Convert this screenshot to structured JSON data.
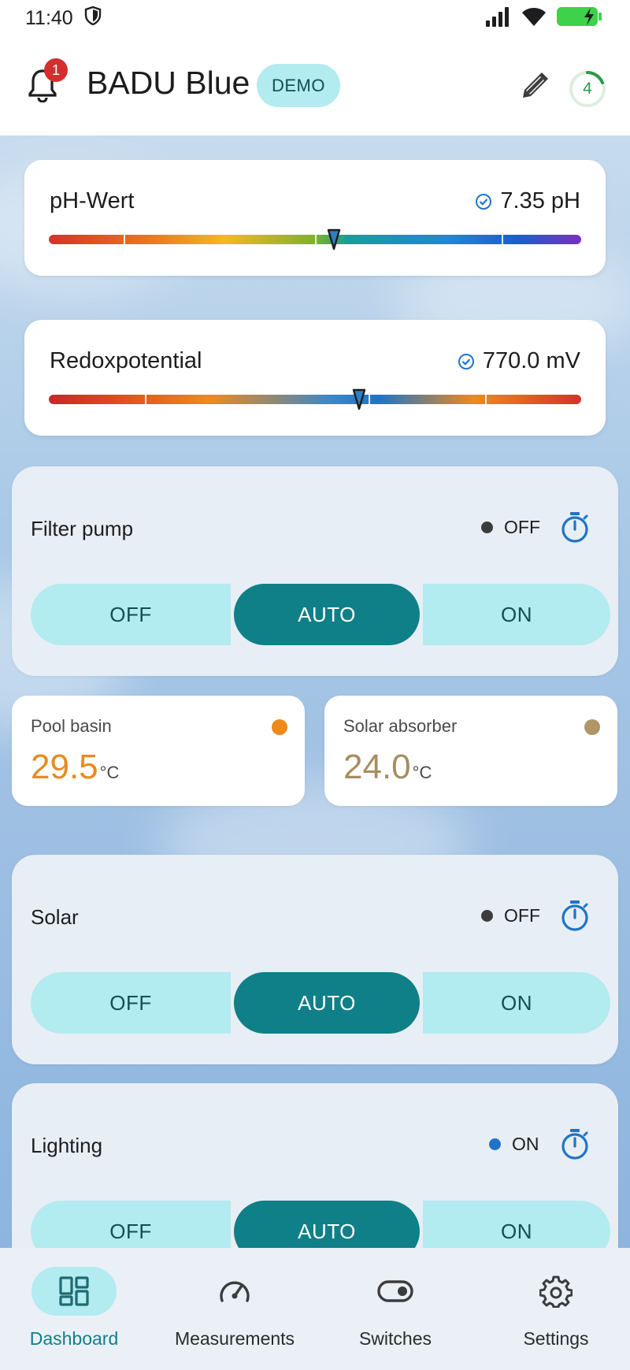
{
  "status_bar": {
    "time": "11:40"
  },
  "header": {
    "notification_count": "1",
    "title": "BADU Blue",
    "badge": "DEMO",
    "progress_value": "4"
  },
  "measurements": {
    "ph": {
      "label": "pH-Wert",
      "value": "7.35 pH",
      "marker_position": 0.535
    },
    "redox": {
      "label": "Redoxpotential",
      "value": "770.0 mV",
      "marker_position": 0.583
    }
  },
  "switches": [
    {
      "title": "Filter pump",
      "status": "OFF",
      "status_color": "#3c3c3c",
      "segments": [
        "OFF",
        "AUTO",
        "ON"
      ],
      "active": "AUTO"
    },
    {
      "title": "Solar",
      "status": "OFF",
      "status_color": "#3c3c3c",
      "segments": [
        "OFF",
        "AUTO",
        "ON"
      ],
      "active": "AUTO"
    },
    {
      "title": "Lighting",
      "status": "ON",
      "status_color": "#1e74c8",
      "segments": [
        "OFF",
        "AUTO",
        "ON"
      ],
      "active": "AUTO"
    }
  ],
  "temperatures": [
    {
      "label": "Pool basin",
      "value": "29.5",
      "unit": "°C",
      "color": "#e88b1f"
    },
    {
      "label": "Solar absorber",
      "value": "24.0",
      "unit": "°C",
      "color": "#a78e60"
    }
  ],
  "bottom_nav": [
    {
      "label": "Dashboard",
      "icon": "dashboard-icon",
      "active": true
    },
    {
      "label": "Measurements",
      "icon": "gauge-icon",
      "active": false
    },
    {
      "label": "Switches",
      "icon": "toggle-icon",
      "active": false
    },
    {
      "label": "Settings",
      "icon": "gear-icon",
      "active": false
    }
  ],
  "colors": {
    "accent": "#0f7f88",
    "accent_light": "#b2ebf0",
    "active_nav": "#0f7f88"
  }
}
